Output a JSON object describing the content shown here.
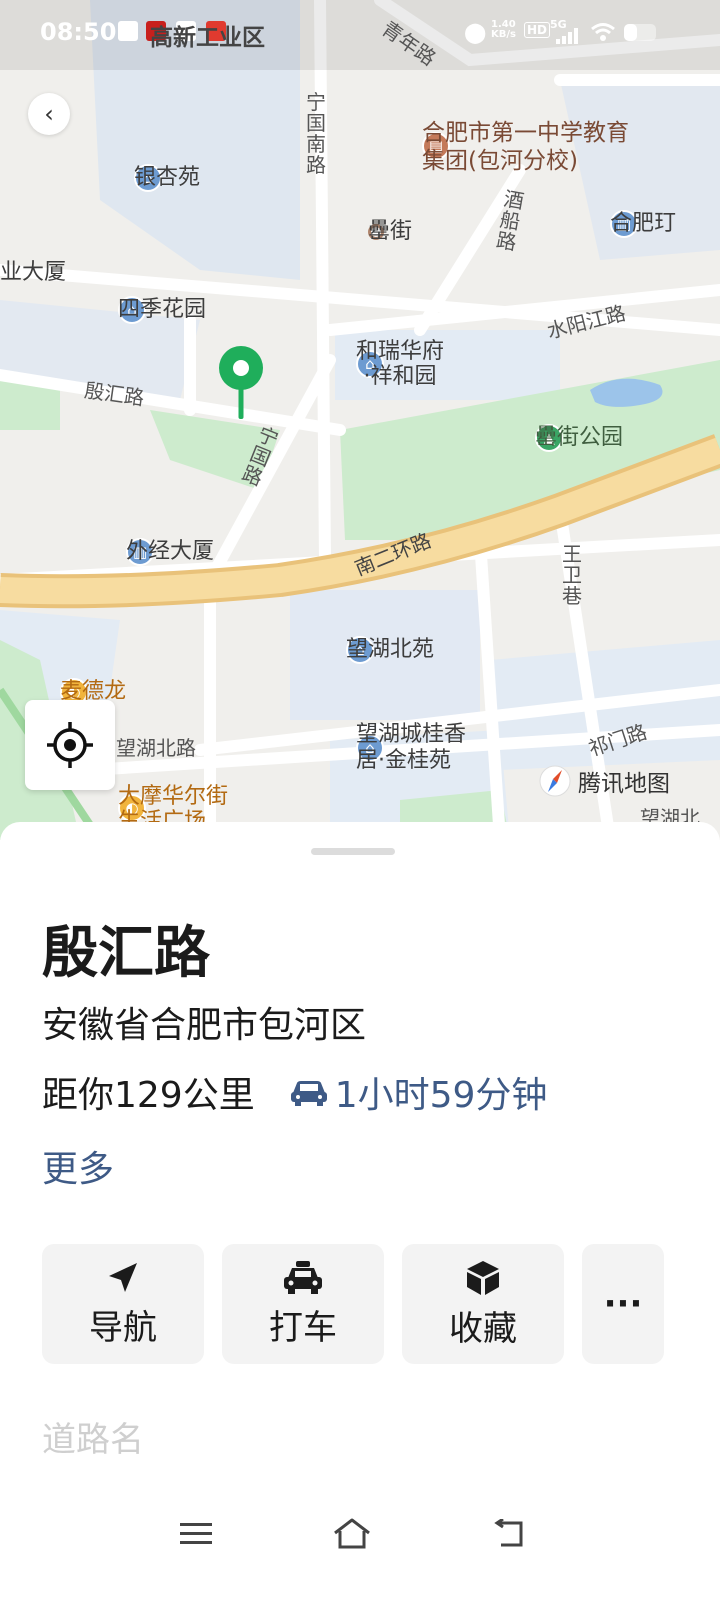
{
  "status_bar": {
    "time": "08:50",
    "network_speed": "1.40\nKB/s",
    "hd_badge": "HD",
    "network_type": "5G",
    "overlay_label": "高新工业区"
  },
  "map": {
    "labels": {
      "yinxing_yuan": "银杏苑",
      "ning_guo_nan_lu": "宁国南路",
      "qing_nian_lu": "青年路",
      "hefei_no1_school": "合肥市第一中学教育\n集团(包河分校)",
      "lei_jie": "罍街",
      "jiu_chuan_lu": "酒船路",
      "hefei_partial": "合肥玎",
      "ye_da_sha": "业大厦",
      "siji_huayuan": "四季花园",
      "shui_yang_jiang_lu": "水阳江路",
      "he_rui_hua_fu": "和瑞华府\n·祥和园",
      "yin_hui_lu": "殷汇路",
      "ning_guo_lu": "宁国路",
      "lei_jie_park": "罍街公园",
      "wai_jing_da_sha": "外经大厦",
      "nan_er_huan_lu": "南二环路",
      "wang_wei_xiang": "王卫巷",
      "wang_hu_bei_yuan": "望湖北苑",
      "mcdonalds": "麦德龙",
      "wang_hu_bei_lu": "望湖北路",
      "wanghu_guixiang": "望湖城桂香\n居·金桂苑",
      "qi_men_lu": "祁门路",
      "damohua": "大摩华尔街\n生活广场",
      "wang_hu_partial": "望湖北",
      "brand": "腾讯地图"
    }
  },
  "place": {
    "name": "殷汇路",
    "address": "安徽省合肥市包河区",
    "distance": "距你129公里",
    "eta": "1小时59分钟",
    "more": "更多"
  },
  "actions": {
    "navigate": "导航",
    "taxi": "打车",
    "favorite": "收藏",
    "more": "···"
  },
  "section_title": "道路名",
  "colors": {
    "accent": "#3e5a86",
    "pin_green": "#1fae5b",
    "highway": "#f5d48c"
  }
}
